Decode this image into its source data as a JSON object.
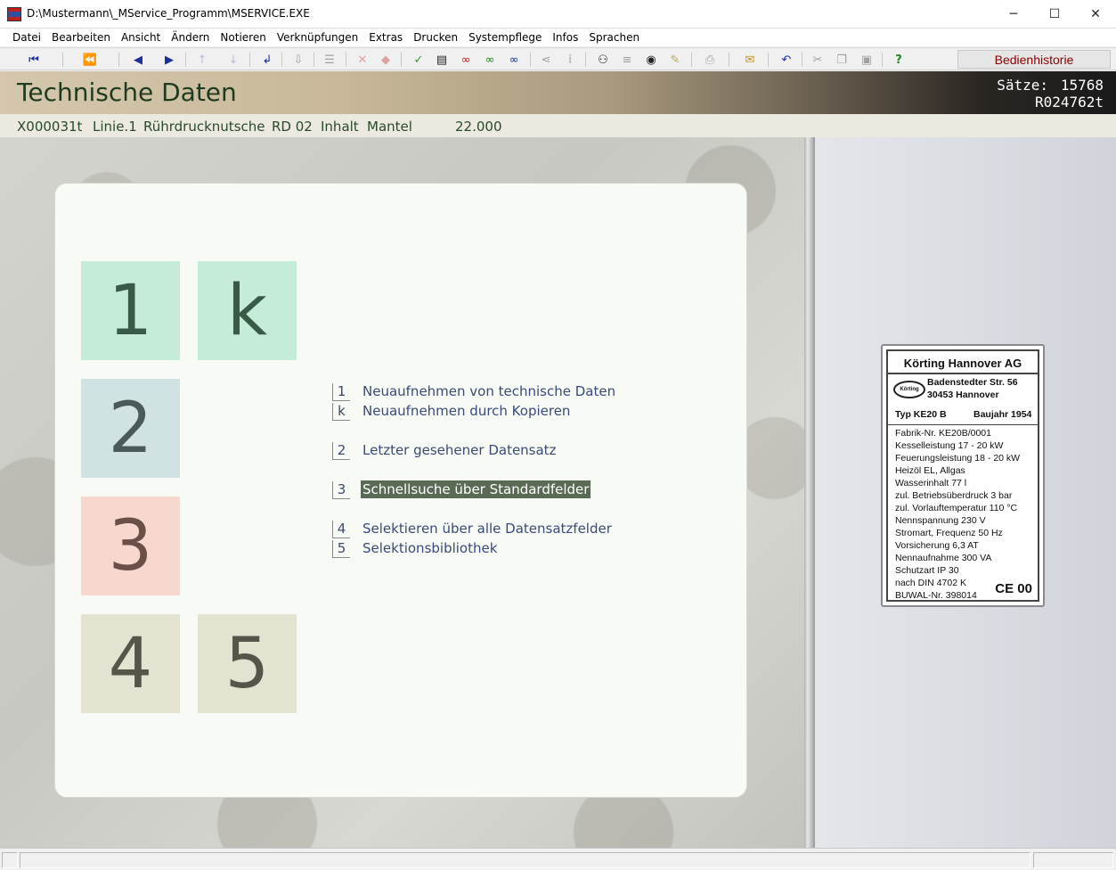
{
  "window": {
    "title": "D:\\Mustermann\\_MService_Programm\\MSERVICE.EXE",
    "minimize": "─",
    "maximize": "☐",
    "close": "✕"
  },
  "menu": [
    "Datei",
    "Bearbeiten",
    "Ansicht",
    "Ändern",
    "Notieren",
    "Verknüpfungen",
    "Extras",
    "Drucken",
    "Systempflege",
    "Infos",
    "Sprachen"
  ],
  "toolbar": {
    "icons": [
      "first-record-icon",
      "previous-page-icon",
      "previous-record-icon",
      "next-record-icon",
      "up-arrow-icon",
      "down-arrow-icon",
      "return-icon",
      "import-icon",
      "list-icon",
      "delete-icon",
      "erase-icon",
      "confirm-icon",
      "form-icon",
      "red-swirl-icon",
      "green-swirl-icon",
      "blue-swirl-icon",
      "share-icon",
      "info-icon",
      "binoculars-icon",
      "lines-icon",
      "eye-icon",
      "brush-icon",
      "print-icon",
      "mail-icon",
      "undo-icon",
      "cut-icon",
      "copy-icon",
      "paste-icon",
      "help-icon"
    ],
    "history_label": "Bedienhistorie"
  },
  "header": {
    "title": "Technische Daten",
    "count_label": "Sätze:",
    "count_value": "15768",
    "record_id": "R024762t"
  },
  "info": {
    "code": "X000031t",
    "line": "Linie.1",
    "name": "Rührdrucknutsche",
    "rd": "RD 02",
    "content_label": "Inhalt",
    "part": "Mantel",
    "value": "22.000"
  },
  "tiles": [
    "1",
    "k",
    "2",
    "3",
    "4",
    "5"
  ],
  "options": [
    {
      "key": "1",
      "label": "Neuaufnehmen von technische Daten"
    },
    {
      "key": "k",
      "label": "Neuaufnehmen durch Kopieren"
    },
    {
      "key": "2",
      "label": "Letzter gesehener Datensatz"
    },
    {
      "key": "3",
      "label": "Schnellsuche über Standardfelder"
    },
    {
      "key": "4",
      "label": "Selektieren über alle Datensatzfelder"
    },
    {
      "key": "5",
      "label": "Selektionsbibliothek"
    }
  ],
  "selected_option": "3",
  "nameplate": {
    "company": "Körting Hannover AG",
    "logo_text": "Körting",
    "street": "Badenstedter Str. 56",
    "city": "30453 Hannover",
    "type": "Typ KE20 B",
    "year": "Baujahr 1954",
    "rows": [
      "Fabrik-Nr.  KE20B/0001",
      "Kesselleistung       17 - 20 kW",
      "Feuerungsleistung  18 - 20 kW",
      "Heizöl EL, Allgas",
      "Wasserinhalt  77 l",
      "zul. Betriebsüberdruck  3 bar",
      "zul. Vorlauftemperatur  110 °C",
      "Nennspannung 230 V",
      "Stromart, Frequenz 50 Hz",
      "Vorsicherung  6,3 AT",
      "Nennaufnahme 300 VA",
      "Schutzart  IP 30",
      "nach DIN 4702 K",
      "BUWAL-Nr. 398014"
    ],
    "mark": "CE 00"
  }
}
